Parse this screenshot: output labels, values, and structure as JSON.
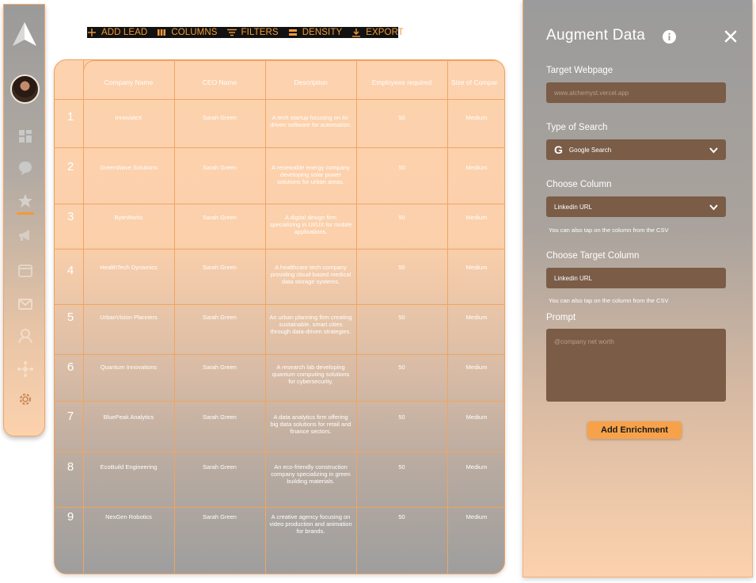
{
  "toolbar": {
    "add_lead": "ADD LEAD",
    "columns": "COLUMNS",
    "filters": "FILTERS",
    "density": "DENSITY",
    "export": "EXPORT"
  },
  "table": {
    "headers": [
      "Company Name",
      "CEO Name",
      "Description",
      "Employees required",
      "Size of Compar"
    ],
    "rows": [
      {
        "num": "1",
        "company": "InnovateX",
        "ceo": "Sarah Green",
        "description": "A tech startup focusing on AI-driven software for automation.",
        "employees": "50",
        "size": "Medium"
      },
      {
        "num": "2",
        "company": "GreenWave Solutions",
        "ceo": "Sarah Green",
        "description": "A renewable energy company developing solar power solutions for urban areas.",
        "employees": "50",
        "size": "Medium"
      },
      {
        "num": "3",
        "company": "ByteWorks",
        "ceo": "Sarah Green",
        "description": "A digital design firm specializing in UI/UX for mobile applications.",
        "employees": "50",
        "size": "Medium"
      },
      {
        "num": "4",
        "company": "HealthTech Dynamics",
        "ceo": "Sarah Green",
        "description": "A healthcare tech company providing cloud-based medical data storage systems.",
        "employees": "50",
        "size": "Medium"
      },
      {
        "num": "5",
        "company": "UrbanVision Planners",
        "ceo": "Sarah Green",
        "description": "An urban planning firm creating sustainable, smart cities through data-driven strategies.",
        "employees": "50",
        "size": "Medium"
      },
      {
        "num": "6",
        "company": "Quantum Innovations",
        "ceo": "Sarah Green",
        "description": "A research lab developing quantum computing solutions for cybersecurity.",
        "employees": "50",
        "size": "Medium"
      },
      {
        "num": "7",
        "company": "BluePeak Analytics",
        "ceo": "Sarah Green",
        "description": "A data analytics firm offering big data solutions for retail and finance sectors.",
        "employees": "50",
        "size": "Medium"
      },
      {
        "num": "8",
        "company": "EcoBuild Engineering",
        "ceo": "Sarah Green",
        "description": "An eco-friendly construction company specializing in green building materials.",
        "employees": "50",
        "size": "Medium"
      },
      {
        "num": "9",
        "company": "NexGen Robotics",
        "ceo": "Sarah Green",
        "description": "A creative agency focusing on video production and animation for brands.",
        "employees": "50",
        "size": "Medium"
      }
    ]
  },
  "panel": {
    "title": "Augment Data",
    "target_webpage_label": "Target Webpage",
    "target_webpage_placeholder": "www.alchemyst.vercel.app",
    "type_of_search_label": "Type of Search",
    "type_of_search_value": "Google Search",
    "choose_column_label": "Choose Column",
    "choose_column_value": "Linkedin URL",
    "choose_column_hint": "You can also tap on the column from the CSV",
    "target_column_label": "Choose Target Column",
    "target_column_value": "Linkedin URL",
    "target_column_hint": "You can also tap on the column from the CSV",
    "prompt_label": "Prompt",
    "prompt_placeholder": "@company net worth",
    "add_button": "Add Enrichment"
  },
  "colors": {
    "accent": "#f29a3a",
    "field_bg": "#7a5c47",
    "panel_top": "#9b9b9b",
    "panel_bottom": "#fcd2ad"
  },
  "icons": {
    "sidebar": [
      "logo-icon",
      "dashboard-icon",
      "chat-icon",
      "star-person-icon",
      "megaphone-icon",
      "calendar-icon",
      "mail-icon",
      "agent-icon",
      "network-icon",
      "gear-icon"
    ]
  }
}
